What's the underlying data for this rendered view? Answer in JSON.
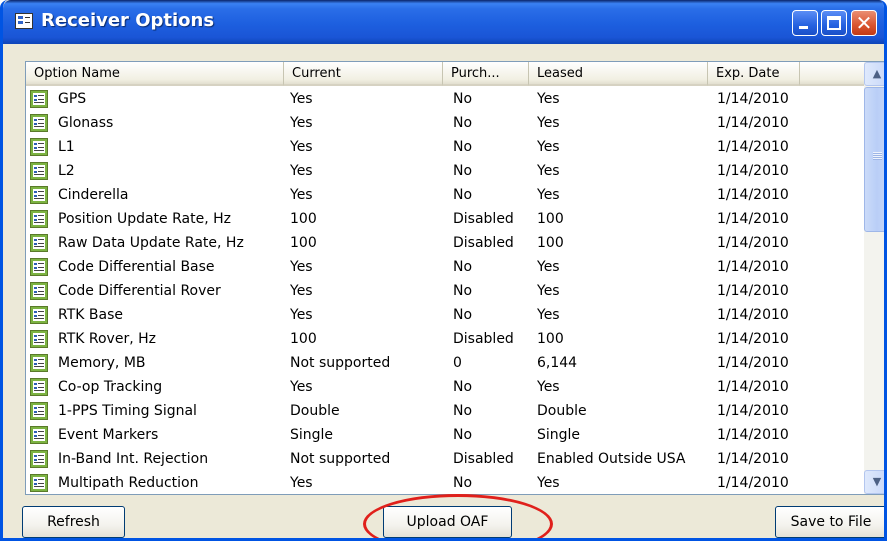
{
  "window": {
    "title": "Receiver Options",
    "accent": "#0054e3",
    "highlight_color": "#e0201b"
  },
  "icons": {
    "window": "window-icon",
    "row": "option-icon",
    "minimize": "minimize-icon",
    "maximize": "maximize-icon",
    "close": "close-icon",
    "scroll_up": "chevron-up-icon",
    "scroll_down": "chevron-down-icon"
  },
  "glyphs": {
    "close": "✕",
    "up": "▲",
    "down": "▼"
  },
  "table": {
    "columns": [
      "Option Name",
      "Current",
      "Purch...",
      "Leased",
      "Exp. Date"
    ],
    "rows": [
      [
        "GPS",
        "Yes",
        "No",
        "Yes",
        "1/14/2010"
      ],
      [
        "Glonass",
        "Yes",
        "No",
        "Yes",
        "1/14/2010"
      ],
      [
        "L1",
        "Yes",
        "No",
        "Yes",
        "1/14/2010"
      ],
      [
        "L2",
        "Yes",
        "No",
        "Yes",
        "1/14/2010"
      ],
      [
        "Cinderella",
        "Yes",
        "No",
        "Yes",
        "1/14/2010"
      ],
      [
        "Position Update Rate, Hz",
        "100",
        "Disabled",
        "100",
        "1/14/2010"
      ],
      [
        "Raw Data Update Rate, Hz",
        "100",
        "Disabled",
        "100",
        "1/14/2010"
      ],
      [
        "Code Differential Base",
        "Yes",
        "No",
        "Yes",
        "1/14/2010"
      ],
      [
        "Code Differential Rover",
        "Yes",
        "No",
        "Yes",
        "1/14/2010"
      ],
      [
        "RTK Base",
        "Yes",
        "No",
        "Yes",
        "1/14/2010"
      ],
      [
        "RTK Rover, Hz",
        "100",
        "Disabled",
        "100",
        "1/14/2010"
      ],
      [
        "Memory, MB",
        "Not supported",
        "0",
        "6,144",
        "1/14/2010"
      ],
      [
        "Co-op Tracking",
        "Yes",
        "No",
        "Yes",
        "1/14/2010"
      ],
      [
        "1-PPS Timing Signal",
        "Double",
        "No",
        "Double",
        "1/14/2010"
      ],
      [
        "Event Markers",
        "Single",
        "No",
        "Single",
        "1/14/2010"
      ],
      [
        "In-Band Int. Rejection",
        "Not supported",
        "Disabled",
        "Enabled Outside USA",
        "1/14/2010"
      ],
      [
        "Multipath Reduction",
        "Yes",
        "No",
        "Yes",
        "1/14/2010"
      ]
    ]
  },
  "buttons": {
    "refresh": "Refresh",
    "upload": "Upload OAF",
    "save": "Save to File"
  }
}
